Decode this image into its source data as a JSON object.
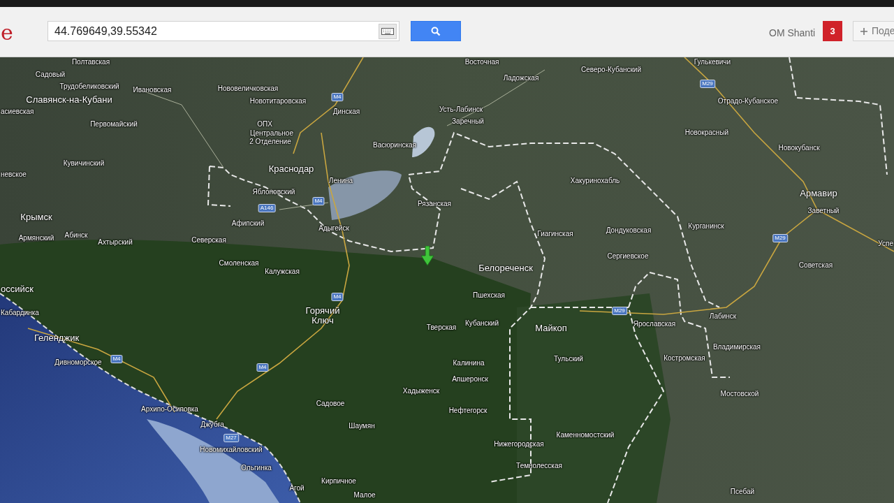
{
  "header": {
    "logo_fragment": "e",
    "search": {
      "value": "44.769649,39.55342"
    },
    "user_name": "OM Shanti",
    "notification_count": "3",
    "share_button": "Поде"
  },
  "map": {
    "labels": [
      {
        "text": "Полтавская",
        "kind": "village"
      },
      {
        "text": "Восточная",
        "kind": "village"
      },
      {
        "text": "Гулькевичи",
        "kind": "village"
      },
      {
        "text": "Садовый",
        "kind": "village"
      },
      {
        "text": "Трудобеликовский",
        "kind": "village"
      },
      {
        "text": "Ивановская",
        "kind": "village"
      },
      {
        "text": "Славянск-на-Кубани",
        "kind": "town"
      },
      {
        "text": "асиевская",
        "kind": "village"
      },
      {
        "text": "Нововеличковская",
        "kind": "village"
      },
      {
        "text": "Новотитаровская",
        "kind": "village"
      },
      {
        "text": "Динская",
        "kind": "village"
      },
      {
        "text": "Усть-Лабинск",
        "kind": "village"
      },
      {
        "text": "Заречный",
        "kind": "village"
      },
      {
        "text": "Первомайский",
        "kind": "village"
      },
      {
        "text": "ОПХ",
        "kind": "village"
      },
      {
        "text": "Центральное",
        "kind": "village"
      },
      {
        "text": "2 Отделение",
        "kind": "village"
      },
      {
        "text": "Васюринская",
        "kind": "village"
      },
      {
        "text": "Кувичинский",
        "kind": "village"
      },
      {
        "text": "невское",
        "kind": "village"
      },
      {
        "text": "Краснодар",
        "kind": "town"
      },
      {
        "text": "Ленина",
        "kind": "village"
      },
      {
        "text": "Яблоновский",
        "kind": "village"
      },
      {
        "text": "Рязанская",
        "kind": "village"
      },
      {
        "text": "Крымск",
        "kind": "town"
      },
      {
        "text": "Афипский",
        "kind": "village"
      },
      {
        "text": "Адыгейск",
        "kind": "village"
      },
      {
        "text": "Армянский",
        "kind": "village"
      },
      {
        "text": "Абинск",
        "kind": "village"
      },
      {
        "text": "Ахтырский",
        "kind": "village"
      },
      {
        "text": "Северская",
        "kind": "village"
      },
      {
        "text": "Смоленская",
        "kind": "village"
      },
      {
        "text": "Калужская",
        "kind": "village"
      },
      {
        "text": "Белореченск",
        "kind": "town"
      },
      {
        "text": "оссийск",
        "kind": "town"
      },
      {
        "text": "Кабардинка",
        "kind": "village"
      },
      {
        "text": "Горячий",
        "kind": "town"
      },
      {
        "text": "Ключ",
        "kind": "town"
      },
      {
        "text": "Геленджик",
        "kind": "town"
      },
      {
        "text": "Дивноморское",
        "kind": "village"
      },
      {
        "text": "Пшехская",
        "kind": "village"
      },
      {
        "text": "Тверская",
        "kind": "village"
      },
      {
        "text": "Кубанский",
        "kind": "village"
      },
      {
        "text": "Майкоп",
        "kind": "town"
      },
      {
        "text": "Ярославская",
        "kind": "village"
      },
      {
        "text": "Лабинск",
        "kind": "village"
      },
      {
        "text": "Владимирская",
        "kind": "village"
      },
      {
        "text": "Тульский",
        "kind": "village"
      },
      {
        "text": "Калинина",
        "kind": "village"
      },
      {
        "text": "Апшеронск",
        "kind": "village"
      },
      {
        "text": "Хадыженск",
        "kind": "village"
      },
      {
        "text": "Костромская",
        "kind": "village"
      },
      {
        "text": "Садовое",
        "kind": "village"
      },
      {
        "text": "Нефтегорск",
        "kind": "village"
      },
      {
        "text": "Архипо-Осиповка",
        "kind": "village"
      },
      {
        "text": "Джубга",
        "kind": "village"
      },
      {
        "text": "Мостовской",
        "kind": "village"
      },
      {
        "text": "Шаумян",
        "kind": "village"
      },
      {
        "text": "Каменномостский",
        "kind": "village"
      },
      {
        "text": "Новомихайловский",
        "kind": "village"
      },
      {
        "text": "Нижегородская",
        "kind": "village"
      },
      {
        "text": "Ольгинка",
        "kind": "village"
      },
      {
        "text": "Темнолесская",
        "kind": "village"
      },
      {
        "text": "Агой",
        "kind": "village"
      },
      {
        "text": "Кирпичное",
        "kind": "village"
      },
      {
        "text": "Малое",
        "kind": "village"
      },
      {
        "text": "Псебай",
        "kind": "village"
      },
      {
        "text": "Северо-Кубанский",
        "kind": "village"
      },
      {
        "text": "Ладожская",
        "kind": "village"
      },
      {
        "text": "Отрадо-Кубанское",
        "kind": "village"
      },
      {
        "text": "Новокрасный",
        "kind": "village"
      },
      {
        "text": "Новокубанск",
        "kind": "village"
      },
      {
        "text": "Хакуринохабль",
        "kind": "village"
      },
      {
        "text": "Армавир",
        "kind": "town"
      },
      {
        "text": "Заветный",
        "kind": "village"
      },
      {
        "text": "Гиагинская",
        "kind": "village"
      },
      {
        "text": "Дондуковская",
        "kind": "village"
      },
      {
        "text": "Курганинск",
        "kind": "village"
      },
      {
        "text": "Успе",
        "kind": "village"
      },
      {
        "text": "Сергиевское",
        "kind": "village"
      },
      {
        "text": "Советская",
        "kind": "village"
      },
      {
        "text": "M4",
        "kind": "road"
      },
      {
        "text": "M4",
        "kind": "road"
      },
      {
        "text": "A146",
        "kind": "road"
      },
      {
        "text": "M4",
        "kind": "road"
      },
      {
        "text": "M4",
        "kind": "road"
      },
      {
        "text": "M4",
        "kind": "road"
      },
      {
        "text": "M27",
        "kind": "road"
      },
      {
        "text": "M29",
        "kind": "road"
      },
      {
        "text": "M29",
        "kind": "road"
      },
      {
        "text": "M29",
        "kind": "road"
      }
    ]
  }
}
